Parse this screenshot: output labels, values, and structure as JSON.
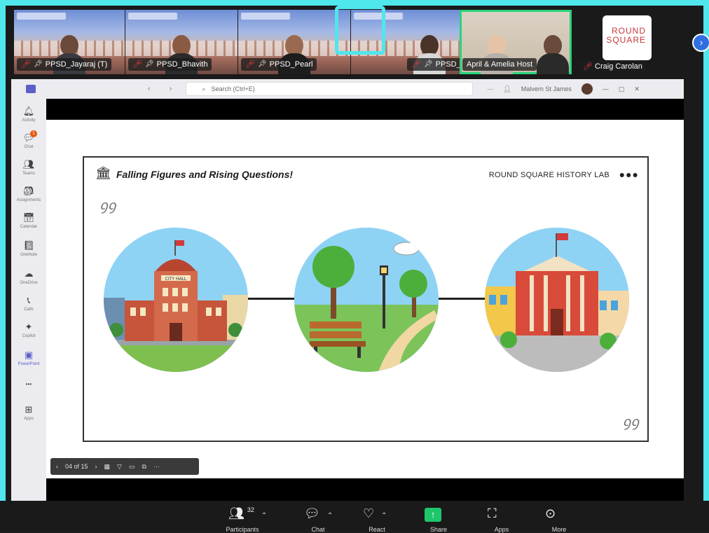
{
  "participants": [
    {
      "name": "PPSD_Jayaraj (T)",
      "muted": true,
      "pinned": true
    },
    {
      "name": "PPSD_Bhavith",
      "muted": true,
      "pinned": true
    },
    {
      "name": "PPSD_Pearl",
      "muted": true,
      "pinned": true
    },
    {
      "name": "",
      "muted": false,
      "pinned": false
    },
    {
      "name": "PPSD_Daksh",
      "muted": true,
      "pinned": true
    },
    {
      "name": "April & Amelia Host",
      "muted": false,
      "pinned": false
    },
    {
      "name": "Craig Carolan",
      "muted": true,
      "pinned": false
    }
  ],
  "logo": {
    "line1": "ROUND",
    "line2": "SQUARE"
  },
  "teams": {
    "search_placeholder": "Search (Ctrl+E)",
    "user_name": "Malvern St James",
    "more": "···",
    "window_controls": [
      "—",
      "▢",
      "✕"
    ]
  },
  "rail": [
    {
      "icon": "bell-icon",
      "glyph": "🔔︎",
      "label": "Activity"
    },
    {
      "icon": "chat-icon",
      "glyph": "💬︎",
      "label": "Chat",
      "badge": "1"
    },
    {
      "icon": "teams-icon",
      "glyph": "👥︎",
      "label": "Teams"
    },
    {
      "icon": "assignments-icon",
      "glyph": "🎒︎",
      "label": "Assignments"
    },
    {
      "icon": "calendar-icon",
      "glyph": "📅︎",
      "label": "Calendar"
    },
    {
      "icon": "onenote-icon",
      "glyph": "📓︎",
      "label": "OneNote"
    },
    {
      "icon": "onedrive-icon",
      "glyph": "☁",
      "label": "OneDrive"
    },
    {
      "icon": "calls-icon",
      "glyph": "📞︎",
      "label": "Calls"
    },
    {
      "icon": "copilot-icon",
      "glyph": "✦",
      "label": "Copilot"
    },
    {
      "icon": "powerpoint-icon",
      "glyph": "▣",
      "label": "PowerPoint",
      "selected": true
    },
    {
      "icon": "more-icon",
      "glyph": "•••",
      "label": ""
    },
    {
      "icon": "apps-icon",
      "glyph": "⊞",
      "label": "Apps"
    }
  ],
  "slide": {
    "title": "Falling Figures and Rising Questions!",
    "brand": "ROUND SQUARE HISTORY LAB",
    "dots": "●●●",
    "city_hall_sign": "CITY HALL"
  },
  "pager": {
    "prev": "‹",
    "label": "04 of 15",
    "next": "›",
    "more": "···"
  },
  "toolbar": {
    "participants_count": "32",
    "participants_label": "Participants",
    "chat_label": "Chat",
    "react_label": "React",
    "share_label": "Share",
    "apps_label": "Apps",
    "more_label": "More"
  },
  "colors": {
    "frame": "#4fe6ec",
    "active_speaker": "#28d37a",
    "share_green": "#1ec76a",
    "teams_purple": "#5b5fc7"
  }
}
